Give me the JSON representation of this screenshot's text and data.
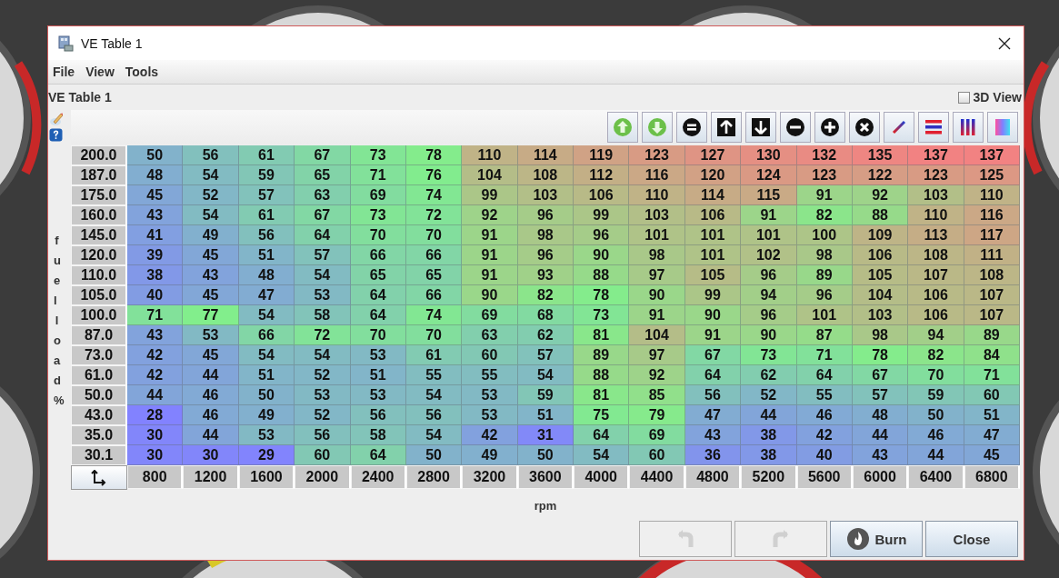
{
  "window": {
    "title": "VE Table 1"
  },
  "menu": [
    {
      "label": "File"
    },
    {
      "label": "View"
    },
    {
      "label": "Tools"
    }
  ],
  "panel_title": "VE Table 1",
  "view_3d": {
    "label": "3D View",
    "checked": false
  },
  "table": {
    "y_axis_label": "fuel load %",
    "x_axis_label": "rpm",
    "rows": [
      {
        "load": "200.0",
        "values": [
          "50",
          "56",
          "61",
          "67",
          "73",
          "78",
          "110",
          "114",
          "119",
          "123",
          "127",
          "130",
          "132",
          "135",
          "137",
          "137"
        ]
      },
      {
        "load": "187.0",
        "values": [
          "48",
          "54",
          "59",
          "65",
          "71",
          "76",
          "104",
          "108",
          "112",
          "116",
          "120",
          "124",
          "123",
          "122",
          "123",
          "125"
        ]
      },
      {
        "load": "175.0",
        "values": [
          "45",
          "52",
          "57",
          "63",
          "69",
          "74",
          "99",
          "103",
          "106",
          "110",
          "114",
          "115",
          "91",
          "92",
          "103",
          "110"
        ]
      },
      {
        "load": "160.0",
        "values": [
          "43",
          "54",
          "61",
          "67",
          "73",
          "72",
          "92",
          "96",
          "99",
          "103",
          "106",
          "91",
          "82",
          "88",
          "110",
          "116"
        ]
      },
      {
        "load": "145.0",
        "values": [
          "41",
          "49",
          "56",
          "64",
          "70",
          "70",
          "91",
          "98",
          "96",
          "101",
          "101",
          "101",
          "100",
          "109",
          "113",
          "117"
        ]
      },
      {
        "load": "120.0",
        "values": [
          "39",
          "45",
          "51",
          "57",
          "66",
          "66",
          "91",
          "96",
          "90",
          "98",
          "101",
          "102",
          "98",
          "106",
          "108",
          "111"
        ]
      },
      {
        "load": "110.0",
        "values": [
          "38",
          "43",
          "48",
          "54",
          "65",
          "65",
          "91",
          "93",
          "88",
          "97",
          "105",
          "96",
          "89",
          "105",
          "107",
          "108"
        ]
      },
      {
        "load": "105.0",
        "values": [
          "40",
          "45",
          "47",
          "53",
          "64",
          "66",
          "90",
          "82",
          "78",
          "90",
          "99",
          "94",
          "96",
          "104",
          "106",
          "107"
        ]
      },
      {
        "load": "100.0",
        "values": [
          "71",
          "77",
          "54",
          "58",
          "64",
          "74",
          "69",
          "68",
          "73",
          "91",
          "90",
          "96",
          "101",
          "103",
          "106",
          "107"
        ]
      },
      {
        "load": "87.0",
        "values": [
          "43",
          "53",
          "66",
          "72",
          "70",
          "70",
          "63",
          "62",
          "81",
          "104",
          "91",
          "90",
          "87",
          "98",
          "94",
          "89"
        ]
      },
      {
        "load": "73.0",
        "values": [
          "42",
          "45",
          "54",
          "54",
          "53",
          "61",
          "60",
          "57",
          "89",
          "97",
          "67",
          "73",
          "71",
          "78",
          "82",
          "84"
        ]
      },
      {
        "load": "61.0",
        "values": [
          "42",
          "44",
          "51",
          "52",
          "51",
          "55",
          "55",
          "54",
          "88",
          "92",
          "64",
          "62",
          "64",
          "67",
          "70",
          "71"
        ]
      },
      {
        "load": "50.0",
        "values": [
          "44",
          "46",
          "50",
          "53",
          "53",
          "54",
          "53",
          "59",
          "81",
          "85",
          "56",
          "52",
          "55",
          "57",
          "59",
          "60"
        ]
      },
      {
        "load": "43.0",
        "values": [
          "28",
          "46",
          "49",
          "52",
          "56",
          "56",
          "53",
          "51",
          "75",
          "79",
          "47",
          "44",
          "46",
          "48",
          "50",
          "51"
        ]
      },
      {
        "load": "35.0",
        "values": [
          "30",
          "44",
          "53",
          "56",
          "58",
          "54",
          "42",
          "31",
          "64",
          "69",
          "43",
          "38",
          "42",
          "44",
          "46",
          "47"
        ]
      },
      {
        "load": "30.1",
        "values": [
          "30",
          "30",
          "29",
          "60",
          "64",
          "50",
          "49",
          "50",
          "54",
          "60",
          "36",
          "38",
          "40",
          "43",
          "44",
          "45"
        ]
      }
    ],
    "rpm": [
      "800",
      "1200",
      "1600",
      "2000",
      "2400",
      "2800",
      "3200",
      "3600",
      "4000",
      "4400",
      "4800",
      "5200",
      "5600",
      "6000",
      "6400",
      "6800"
    ]
  },
  "buttons": [
    {
      "kind": "undo",
      "disabled": true
    },
    {
      "kind": "redo",
      "disabled": true
    },
    {
      "kind": "burn",
      "label": "Burn",
      "disabled": false
    },
    {
      "kind": "close",
      "label": "Close",
      "disabled": false
    }
  ]
}
